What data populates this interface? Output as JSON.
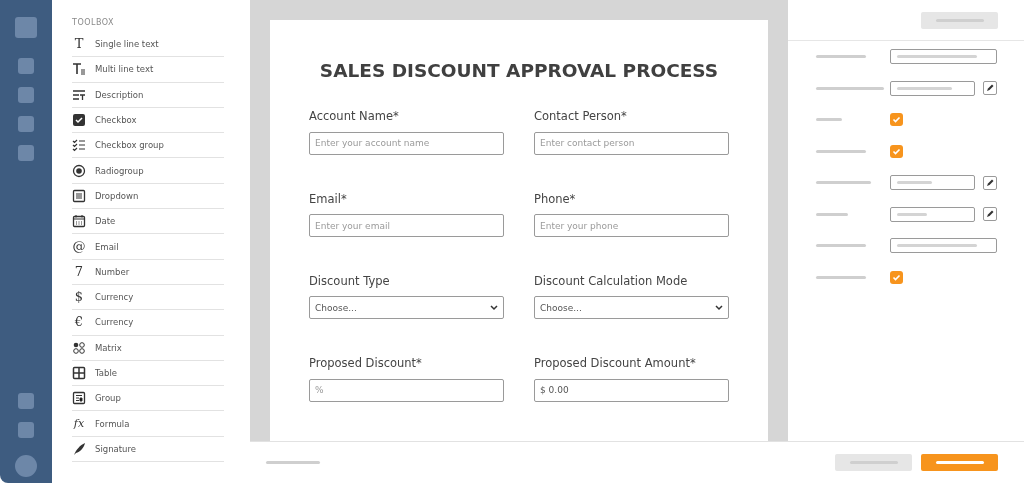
{
  "toolbox": {
    "title": "TOOLBOX",
    "items": [
      {
        "label": "Single line text",
        "kind": "glyph",
        "glyph": "T"
      },
      {
        "label": "Multi line text",
        "kind": "multiline"
      },
      {
        "label": "Description",
        "kind": "description"
      },
      {
        "label": "Checkbox",
        "kind": "checkbox"
      },
      {
        "label": "Checkbox group",
        "kind": "checklist"
      },
      {
        "label": "Radiogroup",
        "kind": "radio"
      },
      {
        "label": "Dropdown",
        "kind": "dropdown"
      },
      {
        "label": "Date",
        "kind": "date"
      },
      {
        "label": "Email",
        "kind": "glyph",
        "glyph": "@"
      },
      {
        "label": "Number",
        "kind": "glyph",
        "glyph": "7"
      },
      {
        "label": "Currency",
        "kind": "glyph",
        "glyph": "$"
      },
      {
        "label": "Currency",
        "kind": "glyph",
        "glyph": "€"
      },
      {
        "label": "Matrix",
        "kind": "matrix"
      },
      {
        "label": "Table",
        "kind": "table"
      },
      {
        "label": "Group",
        "kind": "group"
      },
      {
        "label": "Formula",
        "kind": "glyph",
        "glyph": "fx"
      },
      {
        "label": "Signature",
        "kind": "signature"
      }
    ]
  },
  "form": {
    "title": "SALES DISCOUNT APPROVAL PROCESS",
    "fields": [
      {
        "label": "Account Name*",
        "kind": "text",
        "placeholder": "Enter your account name"
      },
      {
        "label": "Contact Person*",
        "kind": "text",
        "placeholder": "Enter contact person"
      },
      {
        "label": "Email*",
        "kind": "text",
        "placeholder": "Enter your email"
      },
      {
        "label": "Phone*",
        "kind": "text",
        "placeholder": "Enter your phone"
      },
      {
        "label": "Discount Type",
        "kind": "dropdown",
        "value": "Choose..."
      },
      {
        "label": "Discount Calculation Mode",
        "kind": "dropdown",
        "value": "Choose..."
      },
      {
        "label": "Proposed Discount*",
        "kind": "text",
        "placeholder": "%"
      },
      {
        "label": "Proposed Discount Amount*",
        "kind": "text",
        "value": "$ 0.00"
      }
    ]
  },
  "properties": [
    {
      "kind": "field"
    },
    {
      "kind": "field-edit"
    },
    {
      "kind": "checkbox",
      "checked": true
    },
    {
      "kind": "checkbox",
      "checked": true
    },
    {
      "kind": "field-edit"
    },
    {
      "kind": "field-edit"
    },
    {
      "kind": "field"
    },
    {
      "kind": "checkbox",
      "checked": true
    }
  ]
}
